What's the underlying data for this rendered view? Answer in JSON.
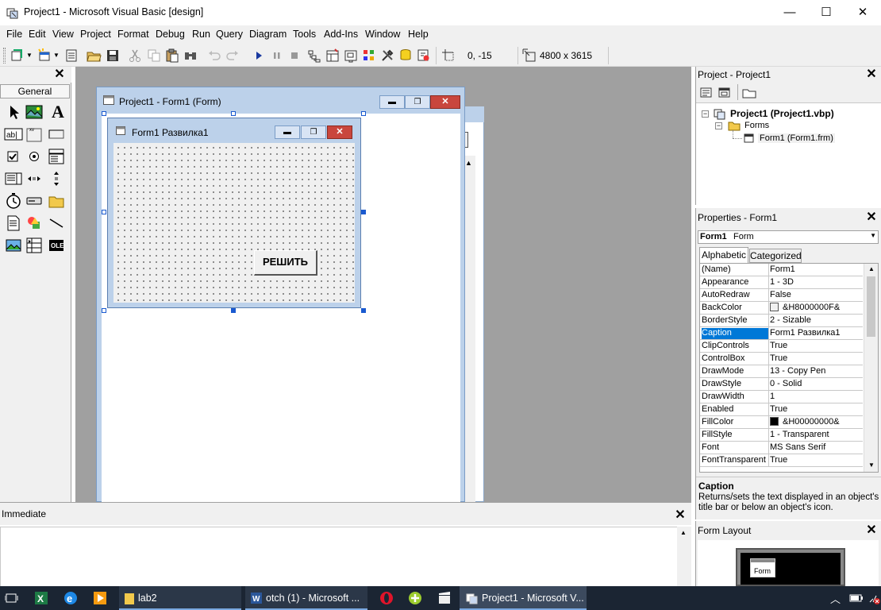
{
  "window": {
    "title": "Project1 - Microsoft Visual Basic [design]",
    "minimize": "—",
    "maximize": "☐",
    "close": "✕"
  },
  "menu": [
    "File",
    "Edit",
    "View",
    "Project",
    "Format",
    "Debug",
    "Run",
    "Query",
    "Diagram",
    "Tools",
    "Add-Ins",
    "Window",
    "Help"
  ],
  "toolbar": {
    "position": "0, -15",
    "size": "4800 x 3615",
    "icons": [
      "add-project-icon",
      "add-form-icon",
      "menu-editor-icon",
      "open-project-icon",
      "save-project-icon",
      "cut-icon",
      "copy-icon",
      "paste-icon",
      "find-icon",
      "undo-icon",
      "redo-icon",
      "start-icon",
      "break-icon",
      "end-icon",
      "project-explorer-icon",
      "properties-window-icon",
      "form-layout-icon",
      "object-browser-icon",
      "toolbox-icon",
      "data-view-icon",
      "component-manager-icon"
    ]
  },
  "toolbox": {
    "tab": "General",
    "tools": [
      "pointer",
      "picturebox",
      "label",
      "textbox",
      "frame",
      "commandbutton",
      "checkbox",
      "optionbutton",
      "combobox",
      "listbox",
      "hscrollbar",
      "vscrollbar",
      "timer",
      "drivelistbox",
      "dirlistbox",
      "filelistbox",
      "shape",
      "line",
      "image",
      "data",
      "ole"
    ]
  },
  "form_designer": {
    "title": "Project1 - Form1 (Form)",
    "form_caption": "Form1 Развилка1",
    "button_caption": "РЕШИТЬ"
  },
  "project": {
    "header": "Project - Project1",
    "root": "Project1 (Project1.vbp)",
    "folder": "Forms",
    "item": "Form1 (Form1.frm)"
  },
  "properties": {
    "header": "Properties - Form1",
    "object_name": "Form1",
    "object_type": "Form",
    "tabs": [
      "Alphabetic",
      "Categorized"
    ],
    "selected": "Caption",
    "rows": [
      {
        "name": "(Name)",
        "value": "Form1"
      },
      {
        "name": "Appearance",
        "value": "1 - 3D"
      },
      {
        "name": "AutoRedraw",
        "value": "False"
      },
      {
        "name": "BackColor",
        "value": "&H8000000F&",
        "swatch": "#f0f0f0"
      },
      {
        "name": "BorderStyle",
        "value": "2 - Sizable"
      },
      {
        "name": "Caption",
        "value": "Form1 Развилка1"
      },
      {
        "name": "ClipControls",
        "value": "True"
      },
      {
        "name": "ControlBox",
        "value": "True"
      },
      {
        "name": "DrawMode",
        "value": "13 - Copy Pen"
      },
      {
        "name": "DrawStyle",
        "value": "0 - Solid"
      },
      {
        "name": "DrawWidth",
        "value": "1"
      },
      {
        "name": "Enabled",
        "value": "True"
      },
      {
        "name": "FillColor",
        "value": "&H00000000&",
        "swatch": "#000000"
      },
      {
        "name": "FillStyle",
        "value": "1 - Transparent"
      },
      {
        "name": "Font",
        "value": "MS Sans Serif"
      },
      {
        "name": "FontTransparent",
        "value": "True"
      }
    ],
    "desc_title": "Caption",
    "desc_text": "Returns/sets the text displayed in an object's title bar or below an object's icon."
  },
  "immediate": {
    "header": "Immediate"
  },
  "form_layout": {
    "header": "Form Layout",
    "mini_label": "Form"
  },
  "taskbar": {
    "items": [
      {
        "label": "lab2"
      },
      {
        "label": "otch (1) - Microsoft ..."
      },
      {
        "label": "Project1 - Microsoft V..."
      }
    ]
  },
  "colors": {
    "accent": "#0078d7",
    "workspace": "#a0a0a0",
    "taskbar": "#1b2533",
    "close_red": "#c9463d",
    "form_border": "#bcd1ea"
  }
}
